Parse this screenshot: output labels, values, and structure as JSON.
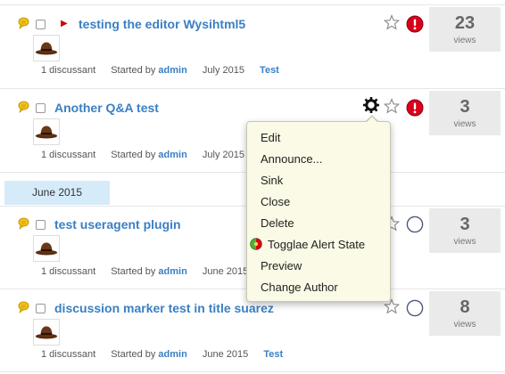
{
  "discussions": [
    {
      "title": "testing the editor Wysihtml5",
      "flagged": true,
      "discussants": "1 discussant",
      "started_by_label": "Started by",
      "author": "admin",
      "date": "July 2015",
      "category": "Test",
      "views_count": "23",
      "views_label": "views",
      "status": "alert"
    },
    {
      "title": "Another Q&A test",
      "flagged": false,
      "discussants": "1 discussant",
      "started_by_label": "Started by",
      "author": "admin",
      "date": "July 2015",
      "category": "",
      "views_count": "3",
      "views_label": "views",
      "status": "alert"
    },
    {
      "title": "test useragent plugin",
      "flagged": false,
      "discussants": "1 discussant",
      "started_by_label": "Started by",
      "author": "admin",
      "date": "June 2015",
      "category": "",
      "views_count": "3",
      "views_label": "views",
      "status": "open"
    },
    {
      "title": "discussion marker test in title suarez",
      "flagged": false,
      "discussants": "1 discussant",
      "started_by_label": "Started by",
      "author": "admin",
      "date": "June 2015",
      "category": "Test",
      "views_count": "8",
      "views_label": "views",
      "status": "open"
    }
  ],
  "date_separator": "June 2015",
  "options_menu": {
    "items": [
      "Edit",
      "Announce...",
      "Sink",
      "Close",
      "Delete",
      "Togglae Alert State",
      "Preview",
      "Change Author"
    ]
  },
  "colors": {
    "link": "#3a7fc3",
    "alert_red": "#d9001b",
    "views_bg": "#eaeaea",
    "menu_bg": "#fafae6",
    "date_separator_bg": "#d6ebfa"
  },
  "icons": [
    "qa-icon",
    "checkbox",
    "flag-icon",
    "avatar-hat",
    "star-icon",
    "alert-icon",
    "status-circle-icon",
    "gear-icon",
    "toggle-alert-icon"
  ]
}
